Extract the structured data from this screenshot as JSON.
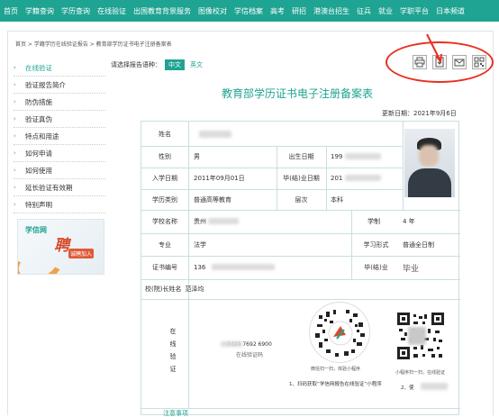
{
  "topnav": [
    "首页",
    "学籍查询",
    "学历查询",
    "在线验证",
    "出国教育背景服务",
    "图像校对",
    "学信档案",
    "高考",
    "研招",
    "港澳台招生",
    "征兵",
    "就业",
    "学职平台",
    "日本频道"
  ],
  "breadcrumb": "首页 > 学籍学历在线验证报告 > 教育部学历证书电子注册备案表",
  "sidebar": [
    "在线验证",
    "验证报告简介",
    "防伪措施",
    "验证真伪",
    "特点和用途",
    "如何申请",
    "如何使用",
    "延长验证有效期",
    "特别声明"
  ],
  "banner": {
    "logo": "学信网",
    "big": "聘",
    "sub": "诚聘加入"
  },
  "lang": {
    "label": "请选择报告语种：",
    "cn": "中文",
    "en": "英文"
  },
  "doc": {
    "title": "教育部学历证书电子注册备案表",
    "updated": "更新日期：2021年9月6日"
  },
  "table": {
    "name_label": "姓名",
    "name_value": "",
    "gender_label": "性别",
    "gender_value": "男",
    "birth_label": "出生日期",
    "birth_value": "199",
    "enroll_label": "入学日期",
    "enroll_value": "2011年09月01日",
    "grad_label": "毕(结)业日期",
    "grad_value": "201",
    "category_label": "学历类别",
    "category_value": "普通高等教育",
    "level_label": "层次",
    "level_value": "本科",
    "school_label": "学校名称",
    "school_value": "贵州",
    "duration_label": "学制",
    "duration_value": "4 年",
    "major_label": "专业",
    "major_value": "法学",
    "form_label": "学习形式",
    "form_value": "普通全日制",
    "cert_label": "证书编号",
    "cert_value": "136",
    "result_label": "毕(结)业",
    "result_value": "毕业",
    "president_label": "校(院)长姓名",
    "president_value": "范泽均",
    "verify_label": "在线验证",
    "verify_code": "0424 7692 6900",
    "verify_code_label": "在线验证码",
    "wx_hint": "微信扫一扫，体验小程序",
    "scan_step": "1、扫码获取“学信网报告在线验证”小程序",
    "mini_hint": "小程序扫一扫，在线验证",
    "step2": "2、使",
    "notice": "注意事项"
  },
  "colors": {
    "brand": "#1fa392",
    "annotation": "#e8301f"
  },
  "icons": [
    "print-icon",
    "download-icon",
    "mail-icon",
    "qr-share-icon"
  ]
}
